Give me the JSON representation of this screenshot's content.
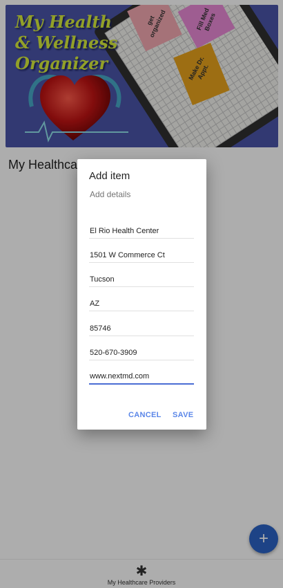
{
  "banner": {
    "title_line1": "My Health",
    "title_line2": "& Wellness",
    "title_line3": "Organizer",
    "notes": [
      "get organized",
      "Fill Med Boxes",
      "Make Dr. Appt."
    ]
  },
  "page": {
    "heading": "My Healthcare Providers"
  },
  "dialog": {
    "title": "Add item",
    "subtitle": "Add details",
    "fields": {
      "name": "El Rio Health Center",
      "street": "1501 W Commerce Ct",
      "city": "Tucson",
      "state": "AZ",
      "zip": "85746",
      "phone": "520-670-3909",
      "website": "www.nextmd.com"
    },
    "cancel_label": "CANCEL",
    "save_label": "SAVE"
  },
  "fab": {
    "label": "+"
  },
  "bottom_nav": {
    "icon": "asterisk-icon",
    "icon_glyph": "✱",
    "label": "My Healthcare Providers"
  },
  "colors": {
    "banner_bg": "#4b55a8",
    "title_yellow": "#d7ec3c",
    "fab_blue": "#2c64c6",
    "button_blue": "#5a86e8",
    "active_underline": "#4a6cd4"
  }
}
